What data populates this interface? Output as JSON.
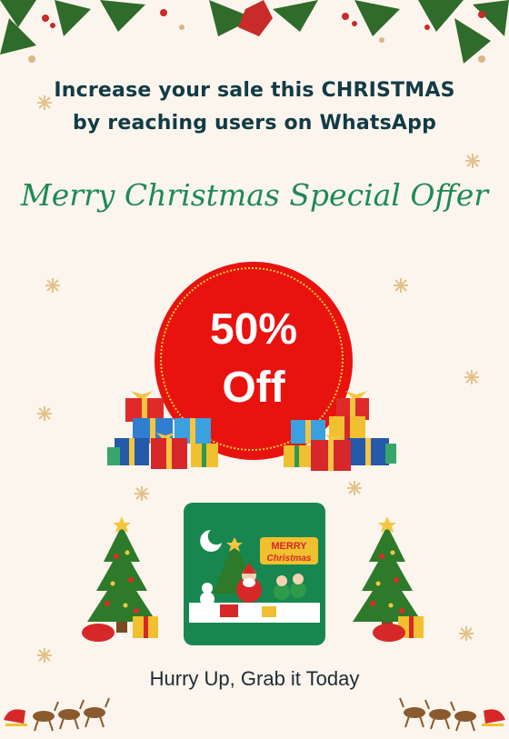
{
  "headline": {
    "line1": "Increase your sale this CHRISTMAS",
    "line2": "by reaching users on WhatsApp"
  },
  "subtitle": "Merry Christmas Special Offer",
  "offer": {
    "percent": "50%",
    "label": "Off"
  },
  "card": {
    "banner_line1": "MERRY",
    "banner_line2": "Christmas"
  },
  "cta": "Hurry Up, Grab it Today",
  "colors": {
    "background": "#fbf5ee",
    "headline": "#123b45",
    "script_title": "#1e8a53",
    "offer_red": "#e8120f",
    "card_green": "#18874f"
  },
  "icons": [
    "holly-garland-icon",
    "snowflake-icon",
    "gift-boxes-icon",
    "christmas-tree-icon",
    "santa-card-icon",
    "reindeer-sleigh-icon"
  ]
}
